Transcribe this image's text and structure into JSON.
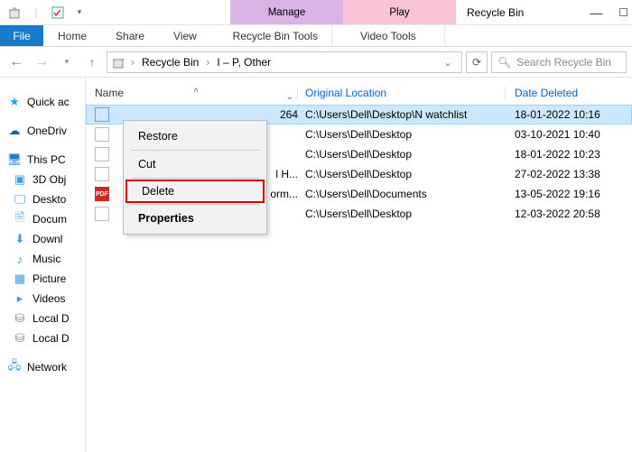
{
  "titlebar": {
    "tool_tabs": {
      "manage": "Manage",
      "play": "Play"
    },
    "window_title": "Recycle Bin",
    "qat": {
      "pin": "📌"
    }
  },
  "ribbon": {
    "file": "File",
    "home": "Home",
    "share": "Share",
    "view": "View",
    "recycle_tools": "Recycle Bin Tools",
    "video_tools": "Video Tools"
  },
  "address": {
    "crumb1": "Recycle Bin",
    "crumb2": "I – P, Other"
  },
  "search": {
    "placeholder": "Search Recycle Bin"
  },
  "sidebar": {
    "quick_access": "Quick ac",
    "onedrive": "OneDriv",
    "this_pc": "This PC",
    "items": [
      "3D Obj",
      "Deskto",
      "Docum",
      "Downl",
      "Music",
      "Picture",
      "Videos",
      "Local D",
      "Local D"
    ],
    "network": "Network"
  },
  "columns": {
    "name": "Name",
    "orig": "Original Location",
    "date": "Date Deleted"
  },
  "rows": [
    {
      "icon": "img",
      "name": "264",
      "orig": "C:\\Users\\Dell\\Desktop\\N watchlist",
      "date": "18-01-2022 10:16",
      "selected": true
    },
    {
      "icon": "txt",
      "name": "",
      "orig": "C:\\Users\\Dell\\Desktop",
      "date": "03-10-2021 10:40",
      "selected": false
    },
    {
      "icon": "txt",
      "name": "",
      "orig": "C:\\Users\\Dell\\Desktop",
      "date": "18-01-2022 10:23",
      "selected": false
    },
    {
      "icon": "txt",
      "name": "l H...",
      "orig": "C:\\Users\\Dell\\Desktop",
      "date": "27-02-2022 13:38",
      "selected": false
    },
    {
      "icon": "pdf",
      "name": "orm...",
      "orig": "C:\\Users\\Dell\\Documents",
      "date": "13-05-2022 19:16",
      "selected": false
    },
    {
      "icon": "txt",
      "name": "",
      "orig": "C:\\Users\\Dell\\Desktop",
      "date": "12-03-2022 20:58",
      "selected": false
    }
  ],
  "context_menu": {
    "restore": "Restore",
    "cut": "Cut",
    "delete": "Delete",
    "properties": "Properties"
  }
}
